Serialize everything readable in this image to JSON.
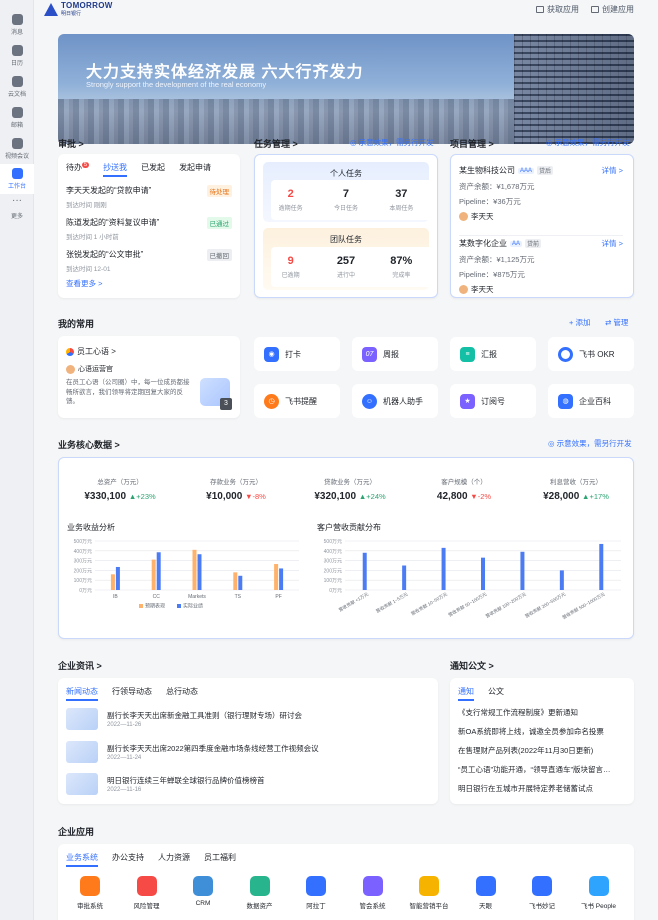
{
  "sidebar": {
    "items": [
      {
        "label": "消息"
      },
      {
        "label": "日历"
      },
      {
        "label": "云文档"
      },
      {
        "label": "邮箱"
      },
      {
        "label": "视频会议"
      },
      {
        "label": "工作台"
      },
      {
        "label": "更多"
      }
    ]
  },
  "header": {
    "brand": "TOMORROW",
    "brand_sub": "明日银行",
    "get_app": "获取应用",
    "create_app": "创建应用"
  },
  "banner": {
    "title": "大力支持实体经济发展  六大行齐发力",
    "subtitle": "Strongly support the development of the real economy"
  },
  "approval": {
    "title": "审批 >",
    "tabs": [
      "待办",
      "抄送我",
      "已发起",
      "发起申请"
    ],
    "pending_badge": "5",
    "items": [
      {
        "title": "李天天发起的“贷款申请”",
        "meta": "到达时间 刚刚",
        "status": "待处理"
      },
      {
        "title": "陈道发起的“资料复议申请”",
        "meta": "到达时间 1 小时前",
        "status": "已通过"
      },
      {
        "title": "张锐发起的“公文审批”",
        "meta": "到达时间 12-01",
        "status": "已撤回"
      }
    ],
    "more": "查看更多 >"
  },
  "tasks": {
    "title": "任务管理 >",
    "link": "示意效果，需另行开发",
    "personal": {
      "label": "个人任务",
      "stats": [
        {
          "value": "2",
          "label": "逾期任务"
        },
        {
          "value": "7",
          "label": "今日任务"
        },
        {
          "value": "37",
          "label": "本周任务"
        }
      ]
    },
    "team": {
      "label": "团队任务",
      "stats": [
        {
          "value": "9",
          "label": "已逾期"
        },
        {
          "value": "257",
          "label": "进行中"
        },
        {
          "value": "87%",
          "label": "完成率"
        }
      ]
    }
  },
  "projects": {
    "title": "项目管理 >",
    "link": "示意效果，需另行开发",
    "items": [
      {
        "name": "某生物科技公司",
        "tag": "AAA",
        "tag2": "贷后",
        "detail": "详情 >",
        "balance": "资产余额：¥1,678万元",
        "pipeline": "Pipeline：¥36万元",
        "owner": "李天天"
      },
      {
        "name": "某数字化企业",
        "tag": "AA",
        "tag2": "贷前",
        "detail": "详情 >",
        "balance": "资产余额：¥1,125万元",
        "pipeline": "Pipeline：¥875万元",
        "owner": "李天天"
      }
    ]
  },
  "common": {
    "title": "我的常用",
    "add": "+ 添加",
    "manage": "管理",
    "feature": {
      "name": "员工心语 >",
      "author": "心语运营官",
      "text": "在员工心语（公司圈）中，每一位成员都接畅所欲言，我们领导将定期回复大家的反馈。",
      "count": "3"
    },
    "apps": [
      "打卡",
      "周报",
      "汇报",
      "飞书 OKR",
      "飞书提醒",
      "机器人助手",
      "订阅号",
      "企业百科"
    ]
  },
  "core": {
    "title": "业务核心数据 >",
    "link": "示意效果，需另行开发",
    "kpis": [
      {
        "label": "总资产（万元）",
        "value": "¥330,100",
        "change": "+23%",
        "dir": "up"
      },
      {
        "label": "存款业务（万元）",
        "value": "¥10,000",
        "change": "-8%",
        "dir": "down"
      },
      {
        "label": "贷款业务（万元）",
        "value": "¥320,100",
        "change": "+24%",
        "dir": "up"
      },
      {
        "label": "客户规模（个）",
        "value": "42,800",
        "change": "-2%",
        "dir": "down"
      },
      {
        "label": "利息营收（万元）",
        "value": "¥28,000",
        "change": "+17%",
        "dir": "up"
      }
    ]
  },
  "chart_data": [
    {
      "type": "bar",
      "title": "业务收益分析",
      "categories": [
        "IB",
        "CC",
        "Markets",
        "TS",
        "PF"
      ],
      "yticks": [
        "500万元",
        "400万元",
        "300万元",
        "200万元",
        "100万元",
        "0万元"
      ],
      "ylim": [
        0,
        500
      ],
      "series": [
        {
          "name": "预期表现",
          "color": "#ffb26b",
          "values": [
            160,
            310,
            410,
            180,
            265
          ]
        },
        {
          "name": "实际业绩",
          "color": "#4c7cf4",
          "values": [
            235,
            385,
            365,
            145,
            220
          ]
        }
      ],
      "legend": "bottom"
    },
    {
      "type": "bar",
      "title": "客户营收贡献分布",
      "categories": [
        "营收贡献 <1万元",
        "营收贡献 1~5万元",
        "营收贡献 10~50万元",
        "营收贡献 50~100万元",
        "营收贡献 100~200万元",
        "营收贡献 200~500万元",
        "营收贡献 500~1000万元"
      ],
      "yticks": [
        "500万元",
        "400万元",
        "300万元",
        "200万元",
        "100万元",
        "0万元"
      ],
      "ylim": [
        0,
        500
      ],
      "series": [
        {
          "color": "#4c7cf4",
          "values": [
            380,
            250,
            430,
            330,
            390,
            200,
            470
          ]
        }
      ]
    }
  ],
  "news": {
    "title": "企业资讯 >",
    "tabs": [
      "新闻动态",
      "行领导动态",
      "总行动态"
    ],
    "items": [
      {
        "title": "副行长李天天出席新金融工具准则（银行理财专场）研讨会",
        "date": "2022—11-26"
      },
      {
        "title": "副行长李天天出席2022第四季度金融市场条线经营工作视频会议",
        "date": "2022—11-24"
      },
      {
        "title": "明日银行连续三年蝉联全球银行品牌价值榜榜首",
        "date": "2022—11-16"
      }
    ]
  },
  "notices": {
    "title": "通知公文 >",
    "tabs": [
      "通知",
      "公文"
    ],
    "items": [
      "《支行常规工作流程制度》更新通知",
      "新OA系统即将上线，诚邀全员参加命名投票",
      "在售理财产品列表(2022年11月30日更新)",
      "“员工心语”功能开通，“领导直通车”版块留言…",
      "明日银行在五城市开展特定养老储蓄试点"
    ]
  },
  "enterprise": {
    "title": "企业应用",
    "tabs": [
      "业务系统",
      "办公支持",
      "人力资源",
      "员工福利"
    ],
    "apps": [
      {
        "label": "审批系统",
        "color": "#ff7a1a"
      },
      {
        "label": "风险管理",
        "color": "#f54a45"
      },
      {
        "label": "CRM",
        "color": "#3f8fd8"
      },
      {
        "label": "数据资产",
        "color": "#28b48c"
      },
      {
        "label": "阿拉丁",
        "color": "#3370ff"
      },
      {
        "label": "管会系统",
        "color": "#7b61ff"
      },
      {
        "label": "智能营销平台",
        "color": "#f6b300"
      },
      {
        "label": "天眼",
        "color": "#3370ff"
      },
      {
        "label": "飞书妙记",
        "color": "#3370ff"
      },
      {
        "label": "飞书 People",
        "color": "#2fa4ff"
      }
    ]
  }
}
